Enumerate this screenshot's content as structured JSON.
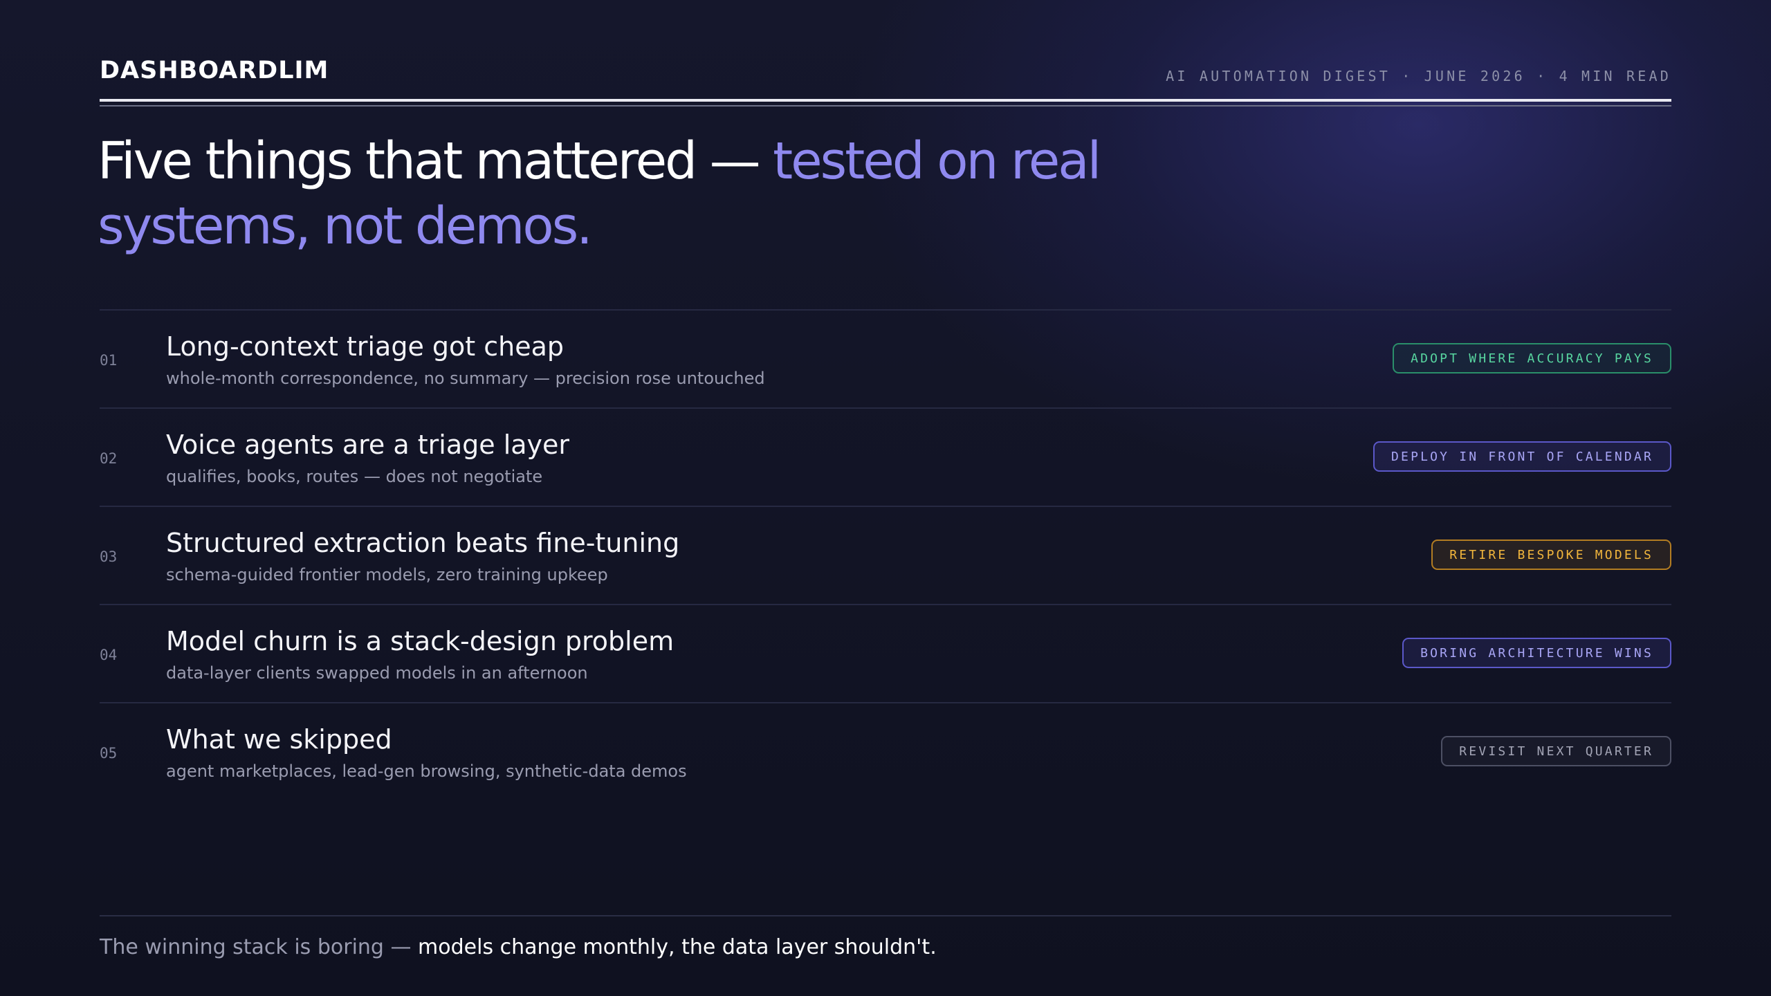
{
  "header": {
    "brand": "DASHBOARDLIM",
    "meta": "AI AUTOMATION DIGEST · JUNE 2026 · 4 MIN READ"
  },
  "headline": {
    "lead": "Five things that mattered — ",
    "accent": "tested on real systems, not demos."
  },
  "items": [
    {
      "num": "01",
      "title": "Long-context triage got cheap",
      "subtitle": "whole-month correspondence, no summary — precision rose untouched",
      "tag": "ADOPT WHERE ACCURACY PAYS",
      "tag_color": "#58d6a0"
    },
    {
      "num": "02",
      "title": "Voice agents are a triage layer",
      "subtitle": "qualifies, books, routes — does not negotiate",
      "tag": "DEPLOY IN FRONT OF CALENDAR",
      "tag_color": "#a9a6f6"
    },
    {
      "num": "03",
      "title": "Structured extraction beats fine-tuning",
      "subtitle": "schema-guided frontier models, zero training upkeep",
      "tag": "RETIRE BESPOKE MODELS",
      "tag_color": "#f2b63c"
    },
    {
      "num": "04",
      "title": "Model churn is a stack-design problem",
      "subtitle": "data-layer clients swapped models in an afternoon",
      "tag": "BORING ARCHITECTURE WINS",
      "tag_color": "#a9a6f6"
    },
    {
      "num": "05",
      "title": "What we skipped",
      "subtitle": "agent marketplaces, lead-gen browsing, synthetic-data demos",
      "tag": "REVISIT NEXT QUARTER",
      "tag_color": "#a3a5b6"
    }
  ],
  "footer": {
    "lead": "The winning stack is boring — ",
    "emphasis": "models change monthly, the data layer shouldn't."
  }
}
